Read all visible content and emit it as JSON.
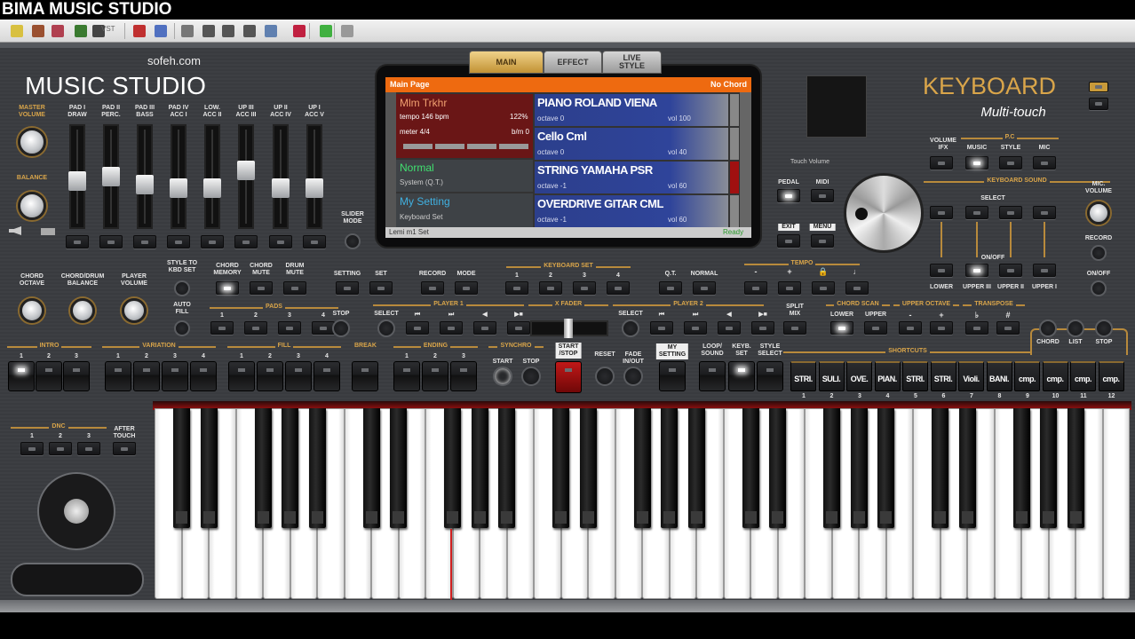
{
  "window": {
    "title": "BIMA MUSIC STUDIO"
  },
  "toolbar": {
    "icons": [
      "open-icon",
      "midi-icon",
      "keyboard-map-icon",
      "save-icon",
      "dropdown-icon",
      "vst-icon",
      "colors-icon",
      "window-icon",
      "screen-icon",
      "key-icon",
      "key-alt-icon",
      "key-selected-icon",
      "panel-icon",
      "music-note-icon",
      "link-icon",
      "gear-icon"
    ],
    "vst_label": "VST"
  },
  "brand": {
    "site": "sofeh.com",
    "name": "MUSIC STUDIO",
    "keyboard": "KEYBOARD",
    "subtitle": "Multi-touch"
  },
  "left": {
    "master_volume": "MASTER\nVOLUME",
    "balance": "BALANCE",
    "slider_mode": "SLIDER\nMODE"
  },
  "sliders": [
    {
      "label": "PAD I\nDRAW",
      "level": 0.45
    },
    {
      "label": "PAD II\nPERC.",
      "level": 0.5
    },
    {
      "label": "PAD III\nBASS",
      "level": 0.4
    },
    {
      "label": "PAD IV\nACC I",
      "level": 0.36
    },
    {
      "label": "LOW.\nACC II",
      "level": 0.36
    },
    {
      "label": "UP III\nACC III",
      "level": 0.58
    },
    {
      "label": "UP II\nACC IV",
      "level": 0.36
    },
    {
      "label": "UP I\nACC V",
      "level": 0.36
    }
  ],
  "display": {
    "tabs": [
      "MAIN",
      "EFFECT",
      "LIVE\nSTYLE"
    ],
    "header": "Main Page",
    "chord": "No Chord",
    "style": {
      "name": "Mlm  Trkhr",
      "tempo": "tempo 146 bpm",
      "percent": "122%",
      "meter": "meter 4/4",
      "measure": "b/m 0"
    },
    "mode": {
      "name": "Normal",
      "detail": "System (Q.T.)"
    },
    "setting": {
      "name": "My Setting",
      "detail": "Keyboard Set"
    },
    "sounds": [
      {
        "name": "PIANO ROLAND VIENA",
        "octave": "octave 0",
        "vol": "vol 100",
        "active": false
      },
      {
        "name": "Cello Cml",
        "octave": "octave 0",
        "vol": "vol 40",
        "active": false
      },
      {
        "name": "STRING YAMAHA PSR",
        "octave": "octave -1",
        "vol": "vol 60",
        "active": true
      },
      {
        "name": "OVERDRIVE GITAR CML",
        "octave": "octave -1",
        "vol": "vol 60",
        "active": false
      }
    ],
    "footer": "Lemi m1 Set",
    "status": "Ready"
  },
  "right": {
    "touch_volume": "Touch Volume",
    "pedal": "PEDAL",
    "midi": "MIDI",
    "exit": "EXIT",
    "menu": "MENU",
    "volume_ifx": "VOLUME\nIFX",
    "pc": "P.C",
    "music": "MUSIC",
    "style": "STYLE",
    "mic": "MIC",
    "keyboard_sound": "KEYBOARD SOUND",
    "select": "SELECT",
    "on_off": "ON/OFF",
    "parts": [
      "LOWER",
      "UPPER III",
      "UPPER II",
      "UPPER I"
    ],
    "mic_volume": "MIC.\nVOLUME",
    "record": "RECORD",
    "mic_on_off": "ON/OFF"
  },
  "row1": {
    "chord_octave": "CHORD\nOCTAVE",
    "chord_drum_balance": "CHORD/DRUM\nBALANCE",
    "player_volume": "PLAYER\nVOLUME",
    "style_to_kbd": "STYLE TO\nKBD SET",
    "chord_memory": "CHORD\nMEMORY",
    "chord_mute": "CHORD\nMUTE",
    "drum_mute": "DRUM\nMUTE",
    "setting": "SETTING",
    "set": "SET",
    "record": "RECORD",
    "mode": "MODE",
    "keyboard_set": "KEYBOARD SET",
    "kbd_nums": [
      "1",
      "2",
      "3",
      "4"
    ],
    "qt": "Q.T.",
    "normal": "NORMAL",
    "tempo": "TEMPO",
    "tempo_btns": [
      "-",
      "+",
      "🔒",
      "♩"
    ]
  },
  "row2": {
    "auto_fill": "AUTO\nFILL",
    "pads": "PADS",
    "pad_nums": [
      "1",
      "2",
      "3",
      "4"
    ],
    "stop": "STOP",
    "player1": "PLAYER 1",
    "player2": "PLAYER 2",
    "xfader": "X FADER",
    "select": "SELECT",
    "transport": [
      "⏮",
      "⏭",
      "◀",
      "▶■"
    ],
    "split_mix": "SPLIT\nMIX",
    "chord_scan": "CHORD SCAN",
    "lower": "LOWER",
    "upper": "UPPER",
    "upper_octave": "UPPER OCTAVE",
    "transpose": "TRANSPOSE",
    "oct_btns": [
      "-",
      "+"
    ],
    "trans_btns": [
      "♭",
      "#"
    ],
    "chord": "CHORD",
    "list": "LIST",
    "stop2": "STOP"
  },
  "row3": {
    "intro": "INTRO",
    "variation": "VARIATION",
    "fill": "FILL",
    "break": "BREAK",
    "ending": "ENDING",
    "synchro": "SYNCHRO",
    "start": "START",
    "stop": "STOP",
    "start_stop": "START\n/STOP",
    "reset": "RESET",
    "fade": "FADE\nIN/OUT",
    "my_setting": "MY\nSETTING",
    "loop_sound": "LOOP/\nSOUND",
    "keyb_set": "KEYB.\nSET",
    "style_select": "STYLE\nSELECT",
    "shortcuts": "SHORTCUTS",
    "nums3": [
      "1",
      "2",
      "3"
    ],
    "nums4": [
      "1",
      "2",
      "3",
      "4"
    ],
    "shortcut_labels": [
      "STRI.",
      "SULI.",
      "OVE.",
      "PIAN.",
      "STRI.",
      "STRI.",
      "Violi.",
      "BANI.",
      "cmp.",
      "cmp.",
      "cmp.",
      "cmp."
    ],
    "shortcut_nums": [
      "1",
      "2",
      "3",
      "4",
      "5",
      "6",
      "7",
      "8",
      "9",
      "10",
      "11",
      "12"
    ]
  },
  "lower_left": {
    "disc": "DNC",
    "nums": [
      "1",
      "2",
      "3"
    ],
    "after_touch": "AFTER\nTOUCH"
  },
  "colors": {
    "accent": "#d9a54a",
    "display_header": "#ee6a10",
    "sound_bg": "#2f449a",
    "active_red": "#a01010"
  },
  "keyboard": {
    "white_keys": 36,
    "first_note": "C"
  }
}
